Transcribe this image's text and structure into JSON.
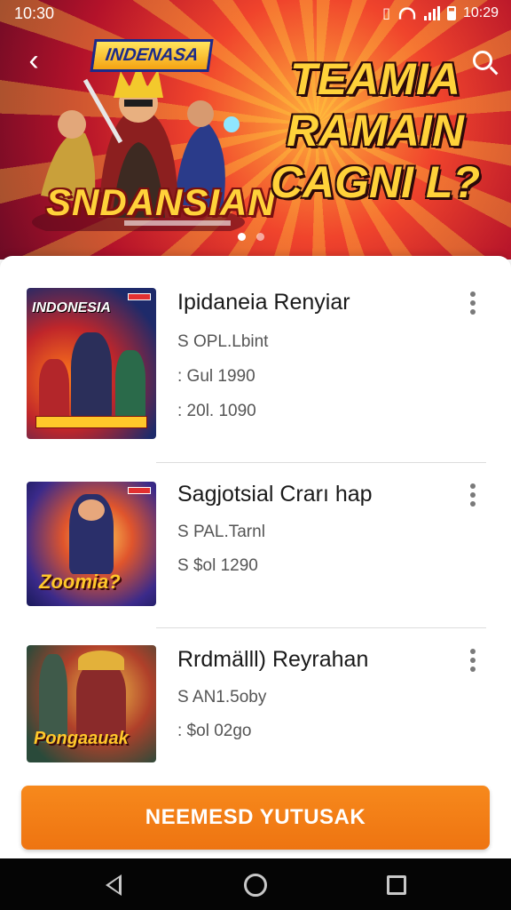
{
  "status_bar": {
    "time": "10:30",
    "right_time": "10:29"
  },
  "hero": {
    "badge": "INDENASA",
    "logo_text": "SNDANSIAN",
    "title_lines": [
      "TEAMIA",
      "RAMAIN",
      "CAGNI L?"
    ],
    "pager": {
      "count": 2,
      "active": 1
    }
  },
  "games": [
    {
      "thumb_text": "INDONESIA",
      "title": "Ipidaneia Renyiar",
      "line1": "S OPL.Lbint",
      "line2": ": Gul 1990",
      "line3": ": 20l. 1090"
    },
    {
      "thumb_text": "Zoomia?",
      "title": "Sagjotsial Crarı hap",
      "line1": "S PAL.Tarnl",
      "line2": "S $ol 1290"
    },
    {
      "thumb_text": "Pongaauak",
      "title": "Rrdmälll) Reyrahan",
      "line1": "S AN1.5oby",
      "line2": ": $ol 02go"
    }
  ],
  "cta": {
    "label": "NEEMESD YUTUSAK"
  },
  "colors": {
    "accent": "#ef7714",
    "hero_red": "#c8182d",
    "title_yellow": "#ffd23a"
  },
  "nav_icons": [
    "back-triangle-icon",
    "home-circle-icon",
    "recents-square-icon"
  ]
}
